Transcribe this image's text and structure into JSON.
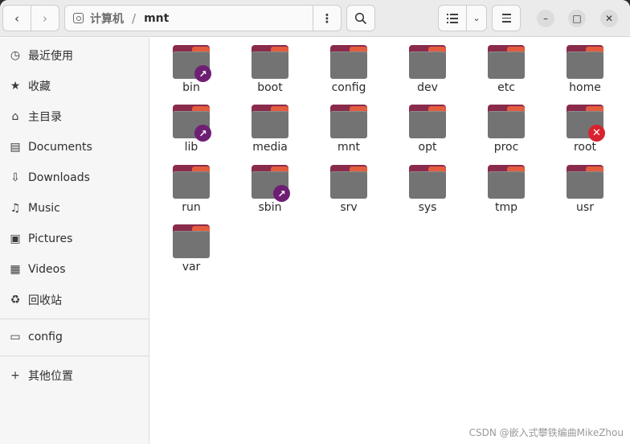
{
  "header": {
    "back_icon": "‹",
    "forward_icon": "›",
    "path_root_label": "计算机",
    "path_separator": "/",
    "path_current_label": "mnt",
    "path_menu_icon": "⋮",
    "search_icon": "search-icon",
    "view_dropdown_icon": "⌄",
    "window_min": "–",
    "window_max": "□",
    "window_close": "✕"
  },
  "sidebar": {
    "items": [
      {
        "label": "最近使用",
        "icon": "◷"
      },
      {
        "label": "收藏",
        "icon": "★"
      },
      {
        "label": "主目录",
        "icon": "⌂"
      },
      {
        "label": "Documents",
        "icon": "▤"
      },
      {
        "label": "Downloads",
        "icon": "⇩"
      },
      {
        "label": "Music",
        "icon": "♫"
      },
      {
        "label": "Pictures",
        "icon": "▣"
      },
      {
        "label": "Videos",
        "icon": "▦"
      },
      {
        "label": "回收站",
        "icon": "♻"
      },
      {
        "label": "config",
        "icon": "▭"
      },
      {
        "label": "其他位置",
        "icon": "+"
      }
    ]
  },
  "files": [
    {
      "name": "bin",
      "emblem": "link"
    },
    {
      "name": "boot",
      "emblem": ""
    },
    {
      "name": "config",
      "emblem": ""
    },
    {
      "name": "dev",
      "emblem": ""
    },
    {
      "name": "etc",
      "emblem": ""
    },
    {
      "name": "home",
      "emblem": ""
    },
    {
      "name": "lib",
      "emblem": "link"
    },
    {
      "name": "media",
      "emblem": ""
    },
    {
      "name": "mnt",
      "emblem": ""
    },
    {
      "name": "opt",
      "emblem": ""
    },
    {
      "name": "proc",
      "emblem": ""
    },
    {
      "name": "root",
      "emblem": "unreadable"
    },
    {
      "name": "run",
      "emblem": ""
    },
    {
      "name": "sbin",
      "emblem": "link"
    },
    {
      "name": "srv",
      "emblem": ""
    },
    {
      "name": "sys",
      "emblem": ""
    },
    {
      "name": "tmp",
      "emblem": ""
    },
    {
      "name": "usr",
      "emblem": ""
    },
    {
      "name": "var",
      "emblem": ""
    }
  ],
  "emblems": {
    "link": "↗",
    "unreadable": "✕"
  },
  "colors": {
    "folder_tab": "#8a2b4c",
    "folder_accent": "#e35c3d",
    "folder_body": "#737373",
    "link_emblem": "#6f1f73",
    "no_access_emblem": "#d9222f"
  },
  "watermark": "CSDN @嵌入式攀铁编曲MikeZhou"
}
